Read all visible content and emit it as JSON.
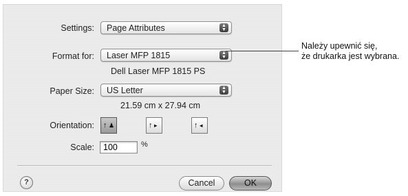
{
  "settings": {
    "label": "Settings:",
    "value": "Page Attributes"
  },
  "format_for": {
    "label": "Format for:",
    "value": "Laser MFP 1815",
    "printer_description": "Dell Laser MFP 1815 PS"
  },
  "paper_size": {
    "label": "Paper Size:",
    "value": "US Letter",
    "dimensions": "21.59 cm x 27.94 cm"
  },
  "orientation": {
    "label": "Orientation:",
    "selected": "portrait",
    "options": [
      "portrait",
      "landscape-left",
      "landscape-right"
    ]
  },
  "scale": {
    "label": "Scale:",
    "value": "100",
    "unit": "%"
  },
  "buttons": {
    "help": "?",
    "cancel": "Cancel",
    "ok": "OK"
  },
  "callout": {
    "line1": "Należy upewnić się,",
    "line2": "że drukarka jest wybrana."
  }
}
